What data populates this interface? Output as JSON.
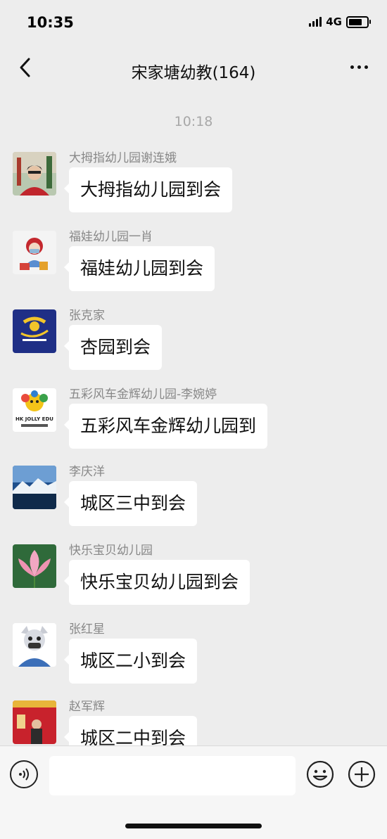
{
  "status_bar": {
    "time": "10:35",
    "network": "4G",
    "battery_level": 0.75
  },
  "header": {
    "back_icon": "chevron-left-icon",
    "title": "宋家塘幼教(164)",
    "more_icon": "more-dots-icon"
  },
  "chat": {
    "timestamp": "10:18",
    "messages": [
      {
        "sender": "大拇指幼儿园谢连娥",
        "text": "大拇指幼儿园到会"
      },
      {
        "sender": "福娃幼儿园一肖",
        "text": "福娃幼儿园到会"
      },
      {
        "sender": "张克家",
        "text": "杏园到会"
      },
      {
        "sender": "五彩风车金辉幼儿园-李婉婷",
        "text": "五彩风车金辉幼儿园到"
      },
      {
        "sender": "李庆洋",
        "text": "城区三中到会"
      },
      {
        "sender": "快乐宝贝幼儿园",
        "text": "快乐宝贝幼儿园到会"
      },
      {
        "sender": "张红星",
        "text": "城区二小到会"
      },
      {
        "sender": "赵军辉",
        "text": "城区二中到会"
      }
    ]
  },
  "input_bar": {
    "voice_icon": "voice-icon",
    "input_value": "",
    "emoji_icon": "emoji-icon",
    "plus_icon": "plus-icon"
  },
  "avatar_text": {
    "logo_small": "HK JOLLY EDU"
  }
}
